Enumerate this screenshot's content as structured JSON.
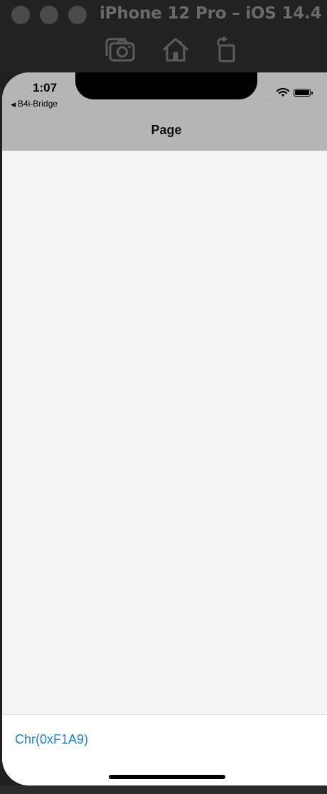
{
  "window": {
    "title": "iPhone 12 Pro – iOS 14.4",
    "toolbar": {
      "screenshot_icon": "camera-icon",
      "home_icon": "home-icon",
      "rotate_icon": "rotate-icon"
    }
  },
  "status_bar": {
    "time": "1:07",
    "back_app": "B4i-Bridge",
    "signal": "····",
    "wifi_icon": "wifi-icon",
    "battery_icon": "battery-icon"
  },
  "nav_bar": {
    "title": "Page"
  },
  "bottom_bar": {
    "label": "Chr(0xF1A9)"
  },
  "colors": {
    "nav_bg": "#b5b5b5",
    "content_bg": "#f4f4f4",
    "link": "#1a7fe0",
    "titlebar_bg": "#222222"
  }
}
